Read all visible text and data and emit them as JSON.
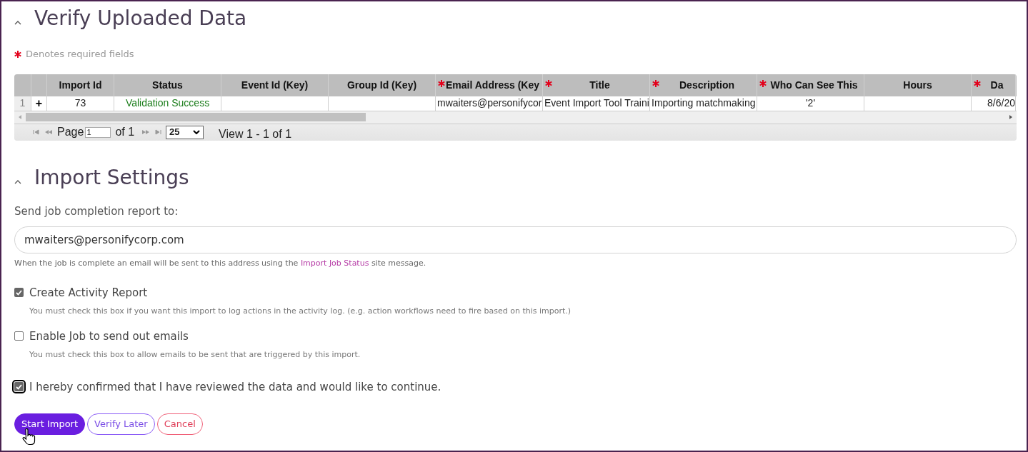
{
  "sections": [
    {
      "title": "Verify Uploaded Data",
      "expanded": true
    },
    {
      "title": "Import Settings",
      "expanded": true
    }
  ],
  "required_note": {
    "text": "Denotes required fields"
  },
  "grid": {
    "columns": [
      {
        "required": false,
        "kind": "rownum"
      },
      {
        "required": false,
        "kind": "expand"
      },
      {
        "label": "Import Id",
        "required": false,
        "kind": "data"
      },
      {
        "label": "Status",
        "required": false,
        "kind": "data"
      },
      {
        "label": "Event Id (Key)",
        "required": false,
        "kind": "data"
      },
      {
        "label": "Group Id (Key)",
        "required": false,
        "kind": "data"
      },
      {
        "label": "Email Address (Key",
        "required": true,
        "kind": "data"
      },
      {
        "label": "Title",
        "required": true,
        "kind": "data"
      },
      {
        "label": "Description",
        "required": true,
        "kind": "data"
      },
      {
        "label": "Who Can See This",
        "required": true,
        "kind": "data"
      },
      {
        "label": "Hours",
        "required": false,
        "kind": "data"
      },
      {
        "label": "Da",
        "required": true,
        "kind": "data"
      }
    ],
    "rows": [
      {
        "cells": [
          "1",
          "+",
          "73",
          "Validation Success",
          "",
          "",
          "mwaiters@personifycor",
          "Event Import Tool Traini",
          "Importing matchmaking",
          "'2'",
          "",
          "8/6/20"
        ]
      }
    ],
    "pager": {
      "page_label": "Page",
      "page_value": "1",
      "of_label": "of 1",
      "page_size": "25",
      "view_text": "View 1 - 1 of 1"
    }
  },
  "report": {
    "label": "Send job completion report to:",
    "value": "mwaiters@personifycorp.com",
    "hint": "When the job is complete an email will be sent to this address using the ",
    "hint_link": "Import Job Status",
    "hint_end": " site message."
  },
  "options": [
    {
      "label": "Create Activity Report",
      "checked": true,
      "help": "You must check this box if you want this import to log actions in the activity log. (e.g. action workflows need to fire based on this import.)"
    },
    {
      "label": "Enable Job to send out emails",
      "checked": false,
      "help": "You must check this box to allow emails to be sent that are triggered by this import."
    }
  ],
  "confirm": {
    "label": "I hereby confirmed that I have reviewed the data and would like to continue.",
    "checked": true
  },
  "buttons": [
    {
      "label": "Start Import",
      "kind": "primary"
    },
    {
      "label": "Verify Later",
      "kind": "secondary"
    },
    {
      "label": "Cancel",
      "kind": "danger"
    }
  ]
}
